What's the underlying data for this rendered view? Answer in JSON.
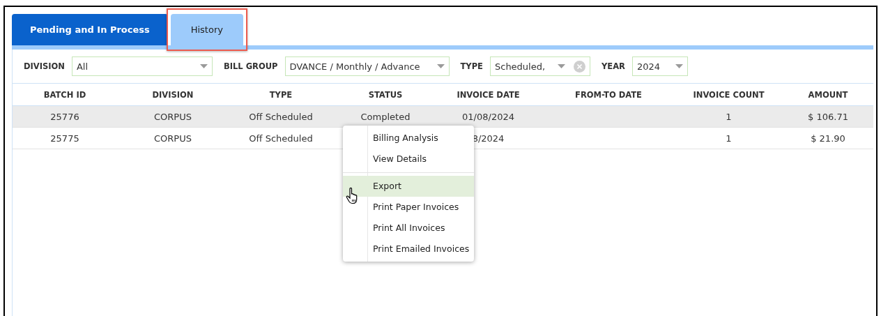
{
  "tabs": [
    {
      "label": "Pending and In Process",
      "selected": false,
      "highlighted": false
    },
    {
      "label": "History",
      "selected": true,
      "highlighted": true
    }
  ],
  "filters": [
    {
      "label": "DIVISION",
      "value": "All",
      "kind": "dropdown"
    },
    {
      "label": "BILL GROUP",
      "value": "DVANCE / Monthly / Advance",
      "kind": "dropdown"
    },
    {
      "label": "TYPE",
      "value": "Scheduled,",
      "kind": "clearable"
    },
    {
      "label": "YEAR",
      "value": "2024",
      "kind": "dropdown"
    }
  ],
  "table": {
    "columns": [
      "BATCH ID",
      "DIVISION",
      "TYPE",
      "STATUS",
      "INVOICE DATE",
      "FROM-TO DATE",
      "INVOICE COUNT",
      "AMOUNT"
    ],
    "rows": [
      {
        "selected": true,
        "cells": [
          "25776",
          "CORPUS",
          "Off Scheduled",
          "Completed",
          "01/08/2024",
          "",
          "1",
          "$ 106.71"
        ]
      },
      {
        "selected": false,
        "cells": [
          "25775",
          "CORPUS",
          "Off Scheduled",
          "",
          "8/2024",
          "",
          "1",
          "$ 21.90"
        ]
      }
    ]
  },
  "context_menu": {
    "groups": [
      [
        {
          "label": "Billing Analysis",
          "selected": false
        },
        {
          "label": "View Details",
          "selected": false
        }
      ],
      [
        {
          "label": "Export",
          "selected": true
        },
        {
          "label": "Print Paper Invoices",
          "selected": false
        },
        {
          "label": "Print All Invoices",
          "selected": false
        },
        {
          "label": "Print Emailed Invoices",
          "selected": false
        }
      ]
    ]
  }
}
